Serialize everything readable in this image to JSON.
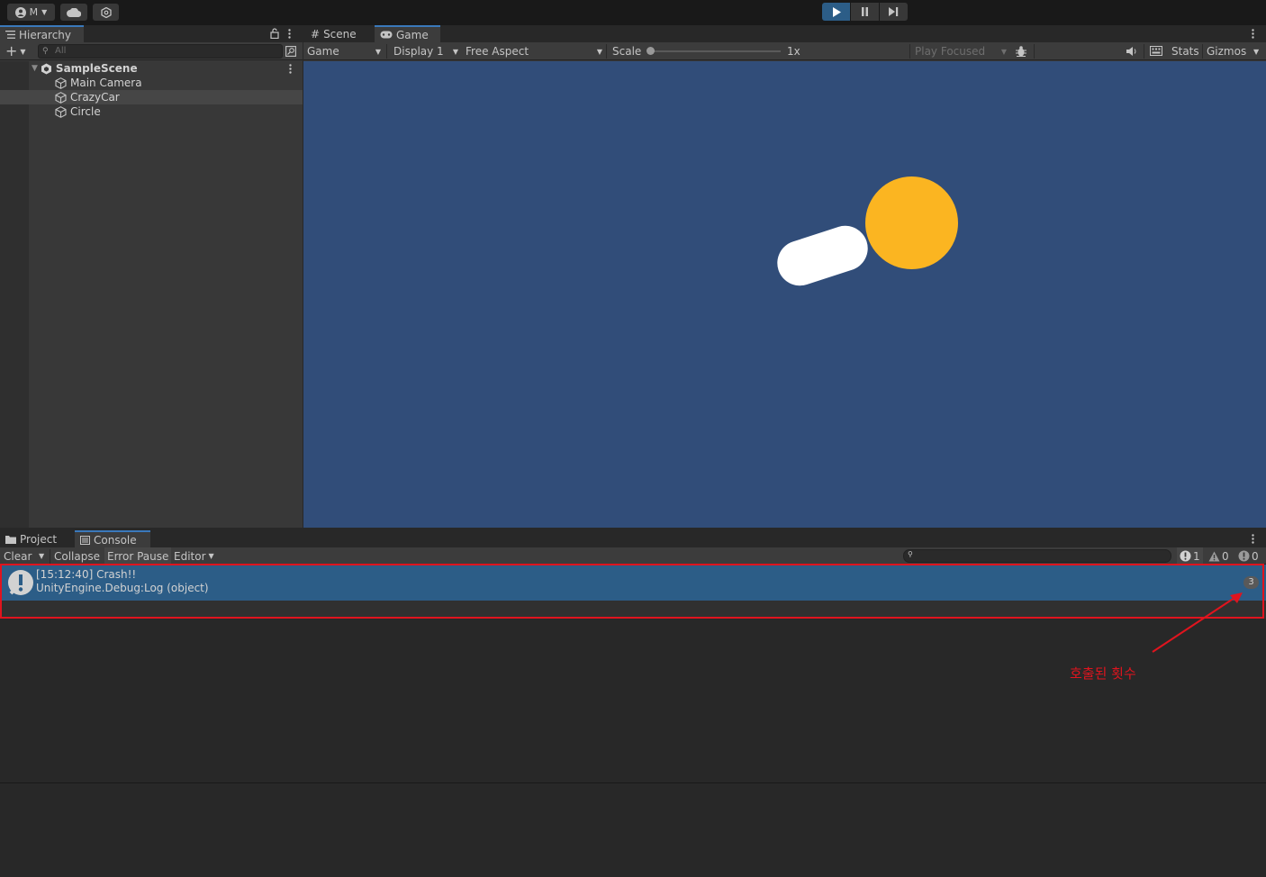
{
  "topbar": {
    "account_label": "M",
    "colors": {
      "play_active": "#2c5d87"
    }
  },
  "hierarchy": {
    "tab_label": "Hierarchy",
    "search_placeholder": "All",
    "scene": "SampleScene",
    "items": [
      {
        "label": "Main Camera",
        "selected": false
      },
      {
        "label": "CrazyCar",
        "selected": true
      },
      {
        "label": "Circle",
        "selected": false
      }
    ]
  },
  "game": {
    "tabs": [
      {
        "label": "Scene"
      },
      {
        "label": "Game"
      }
    ],
    "toolbar": {
      "view_mode": "Game",
      "display": "Display 1",
      "aspect": "Free Aspect",
      "scale_label": "Scale",
      "scale_value": "1x",
      "play_mode": "Play Focused",
      "stats": "Stats",
      "gizmos": "Gizmos"
    },
    "colors": {
      "background": "#314d79",
      "car": "#ffffff",
      "circle": "#fbb521"
    }
  },
  "console": {
    "tabs": [
      {
        "label": "Project"
      },
      {
        "label": "Console"
      }
    ],
    "toolbar": {
      "clear": "Clear",
      "collapse": "Collapse",
      "error_pause": "Error Pause",
      "editor": "Editor",
      "info_count": "1",
      "warning_count": "0",
      "error_count": "0"
    },
    "log": {
      "message": "[15:12:40] Crash!!",
      "stack": "UnityEngine.Debug:Log (object)",
      "count": "3"
    }
  },
  "annotation": {
    "text": "호출된 횟수",
    "color": "#e0141e"
  }
}
